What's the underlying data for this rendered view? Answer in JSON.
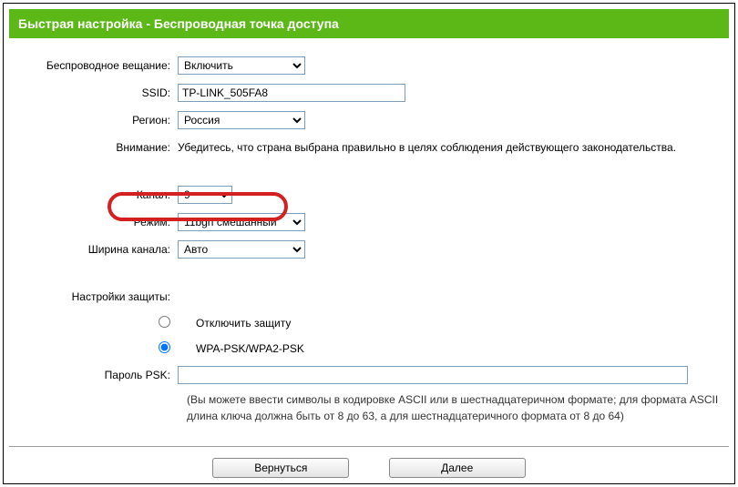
{
  "header": {
    "title": "Быстрая настройка - Беспроводная точка доступа"
  },
  "labels": {
    "wireless_broadcast": "Беспроводное вещание:",
    "ssid": "SSID:",
    "region": "Регион:",
    "warning": "Внимание:",
    "channel": "Канал:",
    "mode": "Режим:",
    "channel_width": "Ширина канала:",
    "security_settings": "Настройки защиты:",
    "psk_password": "Пароль PSK:"
  },
  "fields": {
    "wireless_broadcast": "Включить",
    "ssid": "TP-LINK_505FA8",
    "region": "Россия",
    "warning_text": "Убедитесь, что страна выбрана правильно в целях соблюдения действующего законодательства.",
    "channel": "9",
    "mode": "11bgn смешанный",
    "channel_width": "Авто",
    "psk_password": ""
  },
  "security": {
    "disable": "Отключить защиту",
    "wpa": "WPA-PSK/WPA2-PSK",
    "help": "(Вы можете ввести символы в кодировке ASCII или в шестнадцатеричном формате; для формата ASCII длина ключа должна быть от 8 до 63, а для шестнадцатеричного формата от 8 до 64)"
  },
  "buttons": {
    "back": "Вернуться",
    "next": "Далее"
  }
}
